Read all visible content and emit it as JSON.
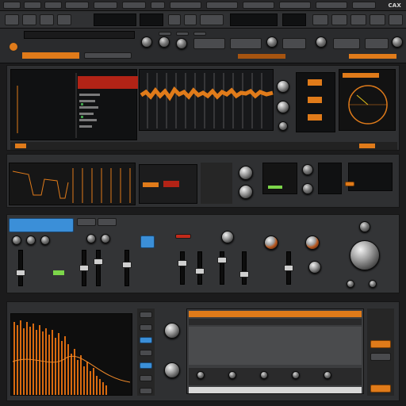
{
  "title_bar": {
    "app_label": "CAX"
  },
  "top_transport": {
    "tempo_display": "",
    "orange_status": ""
  },
  "colors": {
    "accent": "#e07b1a",
    "accent_dark": "#a65410",
    "panel": "#3a3b3d",
    "screen": "#101112",
    "blue": "#3b8fd8",
    "red": "#c22a1a"
  },
  "icons": [
    "knob-icon",
    "fader-icon",
    "orange-button-icon",
    "blue-button-icon",
    "xy-pad-icon",
    "spectrum-icon"
  ],
  "sections": {
    "row1": "arrangement-and-scope",
    "row2": "sequencer-and-fx",
    "row3": "mixer-channel-strips",
    "row4": "spectrum-and-editor"
  }
}
